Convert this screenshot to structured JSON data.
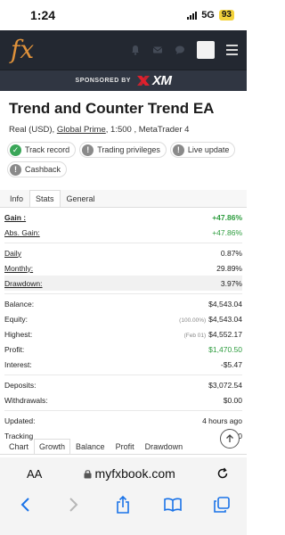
{
  "status_bar": {
    "time": "1:24",
    "network": "5G",
    "battery": "93"
  },
  "header": {
    "logo": "fx"
  },
  "sponsor": {
    "text": "SPONSORED BY",
    "brand": "XM"
  },
  "system": {
    "title": "Trend and Counter Trend EA",
    "account_prefix": "Real (USD), ",
    "broker": "Global Prime",
    "account_suffix": ", 1:500 , MetaTrader 4"
  },
  "badges": [
    {
      "label": "Track record",
      "icon": "check-icon",
      "color": "#3aa658"
    },
    {
      "label": "Trading privileges",
      "icon": "exclamation-icon",
      "color": "#8a8a8a"
    },
    {
      "label": "Live update",
      "icon": "exclamation-icon",
      "color": "#8a8a8a"
    },
    {
      "label": "Cashback",
      "icon": "exclamation-icon",
      "color": "#8a8a8a"
    }
  ],
  "tabs": [
    "Info",
    "Stats",
    "General"
  ],
  "stats": {
    "gain": {
      "label": "Gain :",
      "value": "+47.86%"
    },
    "abs_gain": {
      "label": "Abs. Gain:",
      "value": "+47.86%"
    },
    "daily": {
      "label": "Daily",
      "value": "0.87%"
    },
    "monthly": {
      "label": "Monthly:",
      "value": "29.89%"
    },
    "drawdown": {
      "label": "Drawdown:",
      "value": "3.97%"
    },
    "balance": {
      "label": "Balance:",
      "value": "$4,543.04"
    },
    "equity": {
      "label": "Equity:",
      "note": "(100.00%)",
      "value": "$4,543.04"
    },
    "highest": {
      "label": "Highest:",
      "note": "(Feb 01)",
      "value": "$4,552.17"
    },
    "profit": {
      "label": "Profit:",
      "value": "$1,470.50"
    },
    "interest": {
      "label": "Interest:",
      "value": "-$5.47"
    },
    "deposits": {
      "label": "Deposits:",
      "value": "$3,072.54"
    },
    "withdrawals": {
      "label": "Withdrawals:",
      "value": "$0.00"
    },
    "updated": {
      "label": "Updated:",
      "value": "4 hours ago"
    },
    "tracking": {
      "label": "Tracking",
      "value": "0"
    }
  },
  "bottom_tabs": [
    "Chart",
    "Growth",
    "Balance",
    "Profit",
    "Drawdown"
  ],
  "safari": {
    "text_size": "AA",
    "url": "myfxbook.com"
  },
  "colors": {
    "header_bg": "#232831",
    "sponsor_bg": "#303642",
    "positive": "#2d9c3e",
    "logo": "#e0923a",
    "accent_red": "#e0202c"
  }
}
